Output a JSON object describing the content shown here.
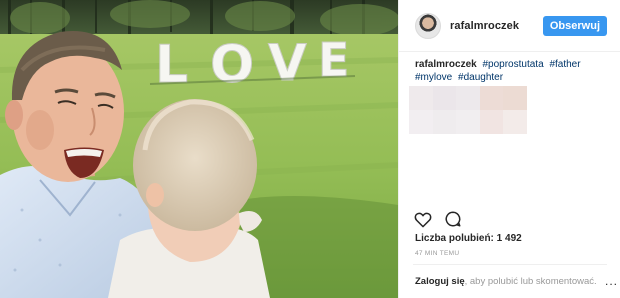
{
  "photo": {
    "sign_letters": [
      "L",
      "O",
      "V",
      "E"
    ]
  },
  "post": {
    "username": "rafalmroczek",
    "follow_label": "Obserwuj",
    "caption": {
      "username": "rafalmroczek",
      "hashtags": [
        "#poprostutata",
        "#father",
        "#mylove",
        "#daughter"
      ]
    },
    "actions": {
      "like_icon": "heart-icon",
      "comment_icon": "comment-icon"
    },
    "likes_label": "Liczba polubień: 1 492",
    "time_label": "47 MIN TEMU",
    "login_link": "Zaloguj się",
    "login_rest": ", aby polubić lub skomentować.",
    "more_label": "..."
  },
  "colors": {
    "follow_button": "#3897f0",
    "hashtag": "#003569",
    "muted_text": "#999999"
  }
}
